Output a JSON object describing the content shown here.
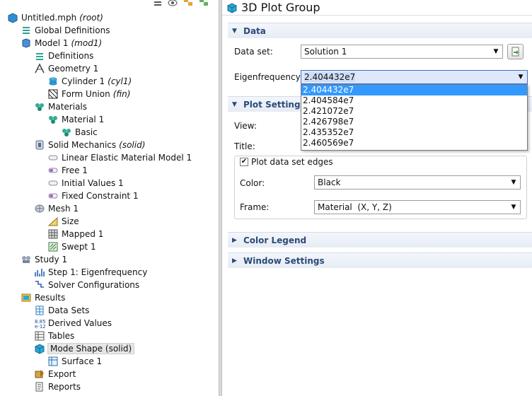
{
  "tree": {
    "items": [
      {
        "label": "Untitled.mph",
        "tag": "(root)",
        "icon": "model-builder-root-icon",
        "level": 0
      },
      {
        "label": "Global Definitions",
        "tag": "",
        "icon": "global-definitions-icon",
        "level": 1
      },
      {
        "label": "Model 1",
        "tag": "(mod1)",
        "icon": "model-icon",
        "level": 1
      },
      {
        "label": "Definitions",
        "tag": "",
        "icon": "definitions-icon",
        "level": 2
      },
      {
        "label": "Geometry 1",
        "tag": "",
        "icon": "geometry-icon",
        "level": 2
      },
      {
        "label": "Cylinder 1",
        "tag": "(cyl1)",
        "icon": "cylinder-icon",
        "level": 3
      },
      {
        "label": "Form Union",
        "tag": "(fin)",
        "icon": "form-union-icon",
        "level": 3
      },
      {
        "label": "Materials",
        "tag": "",
        "icon": "materials-icon",
        "level": 2
      },
      {
        "label": "Material 1",
        "tag": "",
        "icon": "material-icon",
        "level": 3
      },
      {
        "label": "Basic",
        "tag": "",
        "icon": "basic-material-icon",
        "level": 4
      },
      {
        "label": "Solid Mechanics",
        "tag": "(solid)",
        "icon": "solid-mechanics-icon",
        "level": 2
      },
      {
        "label": "Linear Elastic Material Model 1",
        "tag": "",
        "icon": "domain-feature-icon",
        "level": 3
      },
      {
        "label": "Free 1",
        "tag": "",
        "icon": "boundary-feature-icon",
        "level": 3
      },
      {
        "label": "Initial Values 1",
        "tag": "",
        "icon": "domain-feature-icon",
        "level": 3
      },
      {
        "label": "Fixed Constraint 1",
        "tag": "",
        "icon": "boundary-feature-icon",
        "level": 3
      },
      {
        "label": "Mesh 1",
        "tag": "",
        "icon": "mesh-icon",
        "level": 2
      },
      {
        "label": "Size",
        "tag": "",
        "icon": "mesh-size-icon",
        "level": 3
      },
      {
        "label": "Mapped 1",
        "tag": "",
        "icon": "mapped-mesh-icon",
        "level": 3
      },
      {
        "label": "Swept 1",
        "tag": "",
        "icon": "swept-mesh-icon",
        "level": 3
      },
      {
        "label": "Study 1",
        "tag": "",
        "icon": "study-icon",
        "level": 1
      },
      {
        "label": "Step 1: Eigenfrequency",
        "tag": "",
        "icon": "eigenfrequency-step-icon",
        "level": 2
      },
      {
        "label": "Solver Configurations",
        "tag": "",
        "icon": "solver-configurations-icon",
        "level": 2
      },
      {
        "label": "Results",
        "tag": "",
        "icon": "results-icon",
        "level": 1
      },
      {
        "label": "Data Sets",
        "tag": "",
        "icon": "data-sets-icon",
        "level": 2
      },
      {
        "label": "Derived Values",
        "tag": "",
        "icon": "derived-values-icon",
        "level": 2
      },
      {
        "label": "Tables",
        "tag": "",
        "icon": "tables-icon",
        "level": 2
      },
      {
        "label": "Mode Shape (solid)",
        "tag": "",
        "icon": "plot-group-3d-icon",
        "level": 2,
        "selected": true
      },
      {
        "label": "Surface 1",
        "tag": "",
        "icon": "surface-plot-icon",
        "level": 3
      },
      {
        "label": "Export",
        "tag": "",
        "icon": "export-icon",
        "level": 2
      },
      {
        "label": "Reports",
        "tag": "",
        "icon": "reports-icon",
        "level": 2
      }
    ]
  },
  "settings": {
    "title": "3D Plot Group",
    "sections": {
      "data": "Data",
      "plot_settings": "Plot Settings",
      "color_legend": "Color Legend",
      "window_settings": "Window Settings"
    },
    "data_set_label": "Data set:",
    "data_set_value": "Solution 1",
    "eigen_label": "Eigenfrequency:",
    "eigen_value": "2.404432e7",
    "eigen_options": [
      "2.404432e7",
      "2.404584e7",
      "2.421072e7",
      "2.426798e7",
      "2.435352e7",
      "2.460569e7"
    ],
    "view_label": "View:",
    "title_label": "Title:",
    "plot_edges_label": "Plot data set edges",
    "plot_edges_checked": true,
    "color_label": "Color:",
    "color_value": "Black",
    "frame_label": "Frame:",
    "frame_value": "Material  (X, Y, Z)"
  }
}
